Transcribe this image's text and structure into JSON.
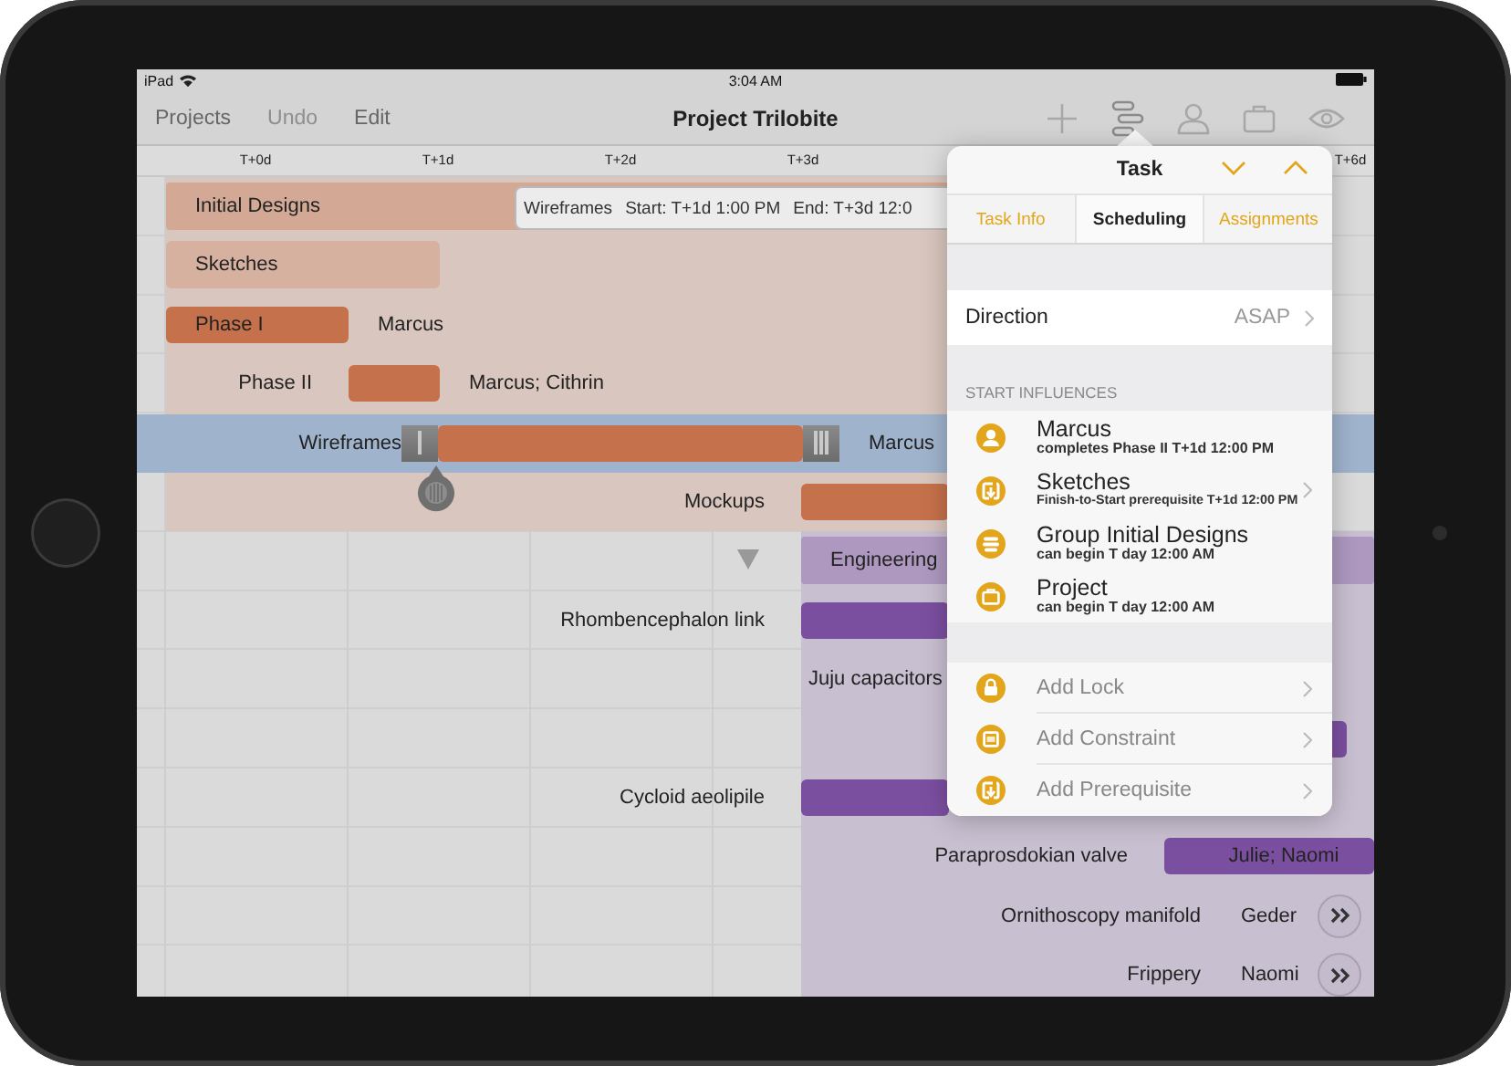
{
  "status_bar": {
    "device": "iPad",
    "time": "3:04 AM"
  },
  "toolbar": {
    "buttons": [
      {
        "label": "Projects",
        "disabled": false
      },
      {
        "label": "Undo",
        "disabled": true
      },
      {
        "label": "Edit",
        "disabled": false
      }
    ],
    "title": "Project Trilobite"
  },
  "timeline": {
    "columns": [
      "T+0d",
      "T+1d",
      "T+2d",
      "T+3d",
      "T+6d"
    ]
  },
  "tooltip": {
    "task": "Wireframes",
    "start": "Start: T+1d 1:00 PM",
    "end": "End: T+3d 12:0"
  },
  "groups": [
    {
      "label": "Initial Designs",
      "color": "#c5714b",
      "tasks": [
        {
          "kind": "group",
          "label": "Sketches",
          "selected": false,
          "children": [
            {
              "kind": "task",
              "label": "Phase I",
              "assignee": "Marcus",
              "selected": false
            },
            {
              "kind": "task",
              "label": "Phase II",
              "assignee": "Marcus; Cithrin",
              "selected": false
            }
          ]
        },
        {
          "kind": "task",
          "label": "Wireframes",
          "assignee": "Marcus",
          "selected": true
        },
        {
          "kind": "task",
          "label": "Mockups",
          "selected": false
        }
      ]
    },
    {
      "label": "Engineering",
      "color": "#7b4fa0",
      "expanded": true,
      "tasks": [
        {
          "kind": "task",
          "label": "Rhombencephalon link",
          "selected": false
        },
        {
          "kind": "task",
          "label": "Juju capacitors",
          "selected": false
        },
        {
          "kind": "task",
          "selected": false
        },
        {
          "kind": "task",
          "label": "Cycloid aeolipile",
          "selected": false
        },
        {
          "kind": "task",
          "label": "Paraprosdokian valve",
          "assignee": "Julie; Naomi",
          "selected": false
        },
        {
          "kind": "task",
          "label": "Ornithoscopy manifold",
          "assignee": "Geder",
          "offscreen": true,
          "selected": false
        },
        {
          "kind": "task",
          "label": "Frippery",
          "assignee": "Naomi",
          "offscreen": true,
          "selected": false
        }
      ]
    }
  ],
  "inspector": {
    "title": "Task",
    "tabs": [
      {
        "label": "Task Info",
        "selected": false
      },
      {
        "label": "Scheduling",
        "selected": true
      },
      {
        "label": "Assignments",
        "selected": false
      }
    ],
    "direction": {
      "label": "Direction",
      "value": "ASAP"
    },
    "section": "START INFLUENCES",
    "influences": [
      {
        "kind": "person",
        "title": "Marcus",
        "detail": "completes Phase II T+1d 12:00 PM",
        "disclosure": false
      },
      {
        "kind": "prerequisite",
        "title": "Sketches",
        "detail": "Finish-to-Start prerequisite T+1d 12:00 PM",
        "disclosure": true
      },
      {
        "kind": "group",
        "title": "Group Initial Designs",
        "detail": "can begin T day 12:00 AM",
        "disclosure": false
      },
      {
        "kind": "project",
        "title": "Project",
        "detail": "can begin T day 12:00 AM",
        "disclosure": false
      }
    ],
    "actions": [
      {
        "kind": "lock",
        "label": "Add Lock"
      },
      {
        "kind": "constraint",
        "label": "Add Constraint"
      },
      {
        "kind": "prerequisite",
        "label": "Add Prerequisite"
      }
    ]
  }
}
